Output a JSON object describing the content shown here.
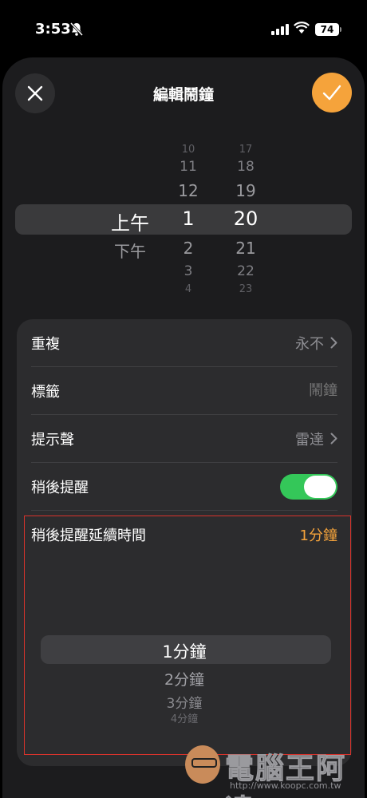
{
  "status_bar": {
    "time": "3:53",
    "battery": "74",
    "icons": [
      "bell-slash-icon",
      "cellular-signal-icon",
      "wifi-icon",
      "battery-icon"
    ]
  },
  "header": {
    "title": "編輯鬧鐘",
    "close_icon": "close-icon",
    "confirm_icon": "checkmark-icon",
    "accent_color": "#f5a33b"
  },
  "time_picker": {
    "ampm": {
      "selected": "上午",
      "below": [
        "下午"
      ]
    },
    "hour": {
      "above": [
        "10",
        "11",
        "12"
      ],
      "selected": "1",
      "below": [
        "2",
        "3",
        "4"
      ]
    },
    "minute": {
      "above": [
        "17",
        "18",
        "19"
      ],
      "selected": "20",
      "below": [
        "21",
        "22",
        "23"
      ]
    }
  },
  "settings": {
    "repeat": {
      "label": "重複",
      "value": "永不"
    },
    "label": {
      "label": "標籤",
      "placeholder": "鬧鐘"
    },
    "sound": {
      "label": "提示聲",
      "value": "雷達"
    },
    "snooze": {
      "label": "稍後提醒",
      "enabled": true,
      "toggle_color": "#34c759"
    },
    "snooze_duration": {
      "label": "稍後提醒延續時間",
      "value": "1分鐘",
      "options": [
        "1分鐘",
        "2分鐘",
        "3分鐘",
        "4分鐘"
      ]
    }
  },
  "watermark": {
    "text": "電腦王阿達",
    "url": "http://www.koopc.com.tw"
  }
}
